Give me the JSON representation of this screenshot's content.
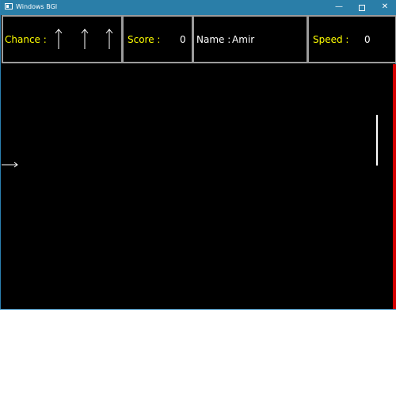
{
  "window": {
    "title": "Windows BGI",
    "controls": {
      "minimize": "—",
      "close": "✕"
    }
  },
  "hud": {
    "chance_label": "Chance :",
    "chances_remaining": 3,
    "chance_icon": "up-arrow-icon",
    "score_label": "Score :",
    "score_value": "0",
    "name_label": "Name :",
    "name_value": "Amir",
    "speed_label": "Speed :",
    "speed_value": "0"
  },
  "playfield": {
    "wall_color": "#d40000",
    "paddle_color": "#ffffff",
    "player_icon": "right-arrow-icon"
  },
  "colors": {
    "titlebar": "#2a7ea8",
    "label": "#ffff00",
    "value": "#ffffff",
    "box_border": "#9b9b9b",
    "background": "#000000"
  }
}
